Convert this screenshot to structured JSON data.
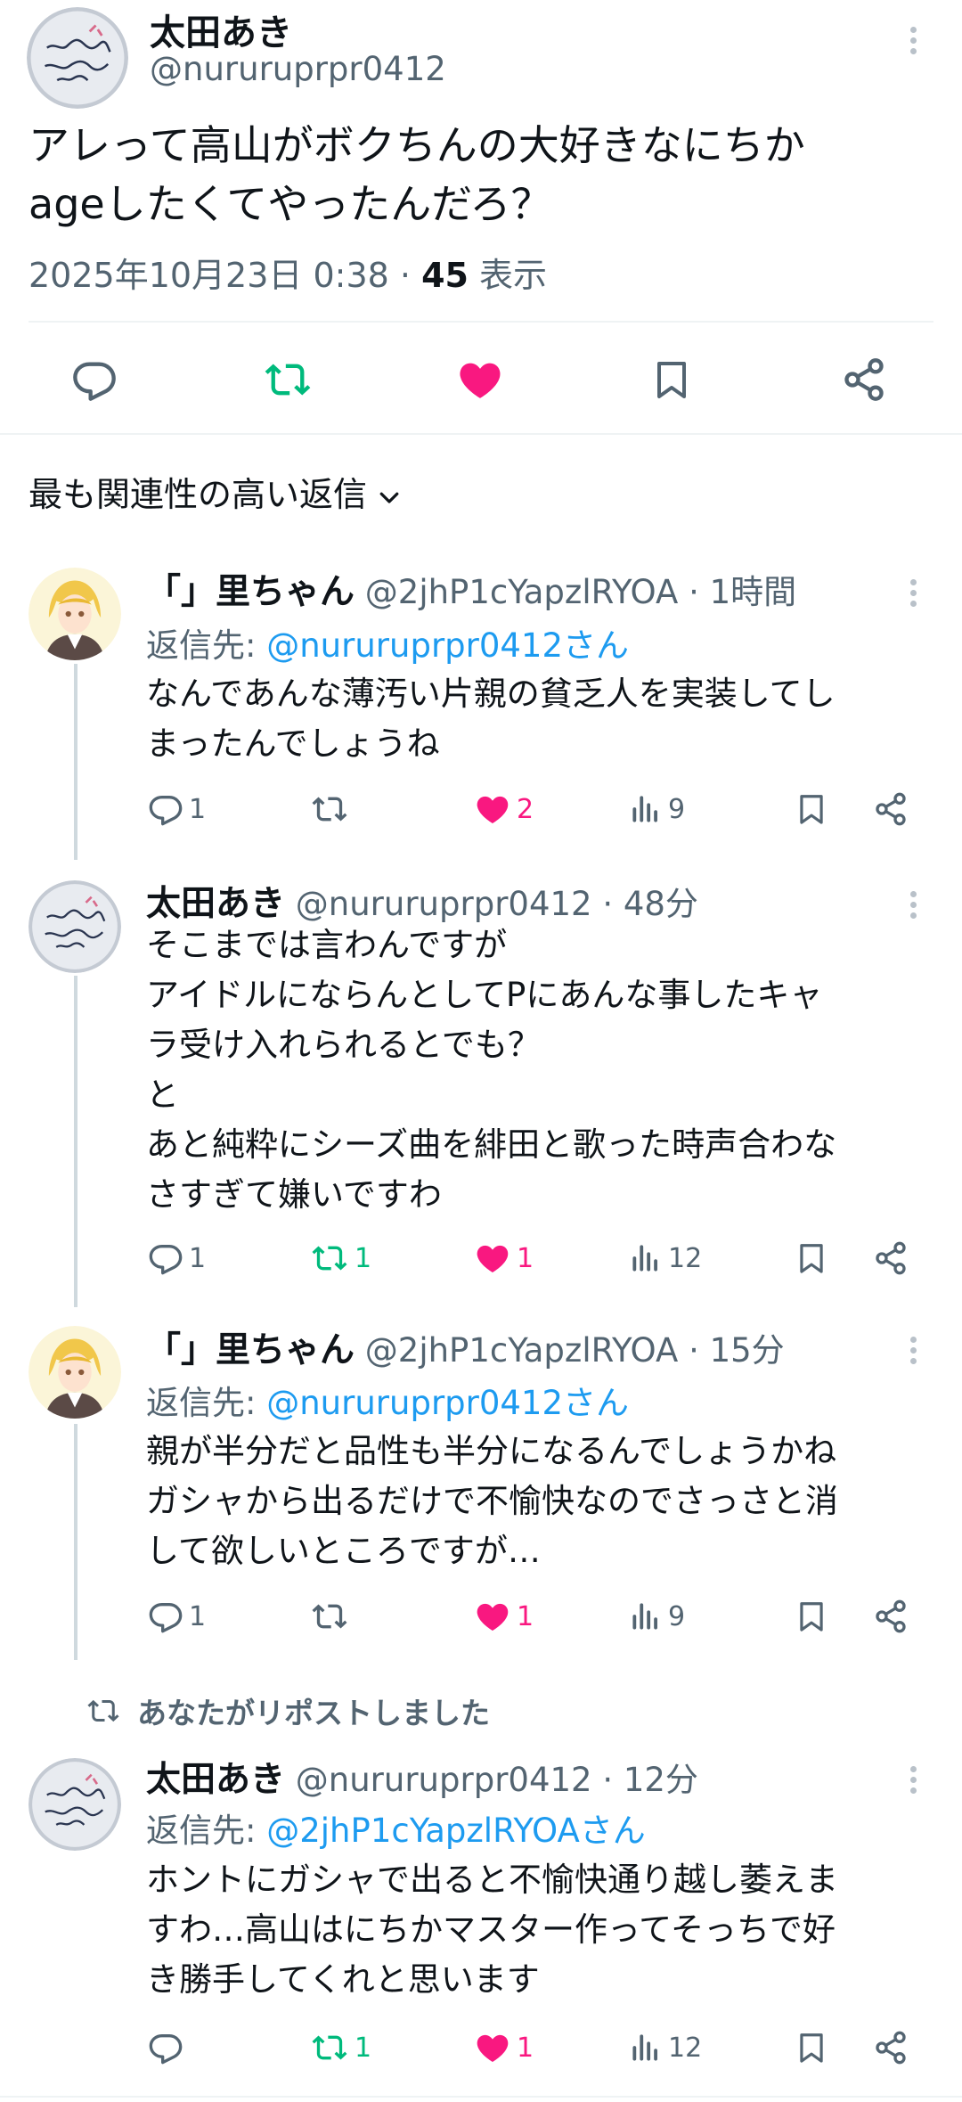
{
  "main_tweet": {
    "name": "太田あき",
    "handle": "@nururuprpr0412",
    "text_line1": "アレって高山がボクちんの大好きなにちか",
    "text_line2": "ageしたくてやったんだろ？",
    "timestamp": "2025年10月23日 0:38 · ",
    "views": "45",
    "views_label": " 表示"
  },
  "sort_label": "最も関連性の高い返信",
  "replies": [
    {
      "name": "「」里ちゃん",
      "handle": "@2jhP1cYapzlRYOA · 1時間",
      "reply_to_prefix": "返信先: ",
      "reply_to": "@nururuprpr0412さん",
      "lines": [
        "なんであんな薄汚い片親の貧乏人を実装してし",
        "まったんでしょうね"
      ],
      "replies": "1",
      "retweets": "",
      "likes": "2",
      "views": "9"
    },
    {
      "name": "太田あき",
      "handle": "@nururuprpr0412 · 48分",
      "lines": [
        "そこまでは言わんですが",
        "アイドルにならんとしてPにあんな事したキャ",
        "ラ受け入れられるとでも？",
        "と",
        "あと純粋にシーズ曲を緋田と歌った時声合わな",
        "さすぎて嫌いですわ"
      ],
      "replies": "1",
      "retweets": "1",
      "likes": "1",
      "views": "12"
    },
    {
      "name": "「」里ちゃん",
      "handle": "@2jhP1cYapzlRYOA · 15分",
      "reply_to_prefix": "返信先: ",
      "reply_to": "@nururuprpr0412さん",
      "lines": [
        "親が半分だと品性も半分になるんでしょうかね",
        "ガシャから出るだけで不愉快なのでさっさと消",
        "して欲しいところですが…"
      ],
      "replies": "1",
      "retweets": "",
      "likes": "1",
      "views": "9"
    },
    {
      "reposted_label": "あなたがリポストしました",
      "name": "太田あき",
      "handle": "@nururuprpr0412 · 12分",
      "reply_to_prefix": "返信先: ",
      "reply_to": "@2jhP1cYapzlRYOAさん",
      "lines": [
        "ホントにガシャで出ると不愉快通り越し萎えま",
        "すわ…高山はにちかマスター作ってそっちで好",
        "き勝手してくれと思います"
      ],
      "replies": "",
      "retweets": "1",
      "likes": "1",
      "views": "12"
    }
  ],
  "icons": [
    "reply-icon",
    "retweet-icon",
    "like-icon",
    "bookmark-icon",
    "share-icon",
    "views-icon",
    "more-icon",
    "chevron-down-icon"
  ],
  "colors": {
    "text": "#0f1419",
    "muted": "#536471",
    "link": "#1d9bf0",
    "like": "#f91880",
    "retweet": "#00ba7c",
    "divider": "#eff3f4"
  }
}
